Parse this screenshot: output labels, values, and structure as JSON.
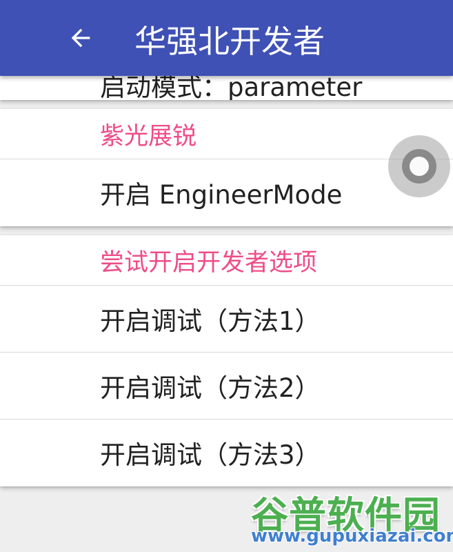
{
  "appbar": {
    "title": "华强北开发者",
    "back_icon": "arrow-back-icon",
    "color": "#3f51b5"
  },
  "cut_item": {
    "label": "启动模式：parameter"
  },
  "sections": [
    {
      "header": "紫光展锐",
      "items": [
        "开启 EngineerMode"
      ]
    },
    {
      "header": "尝试开启开发者选项",
      "items": [
        "开启调试（方法1）",
        "开启调试（方法2）",
        "开启调试（方法3）"
      ]
    }
  ],
  "floating_button": {
    "icon": "circle-ring-icon"
  },
  "watermark": {
    "brand": "谷普软件园",
    "url": "www.gupuxiazai.com"
  },
  "colors": {
    "accent": "#ee4d88",
    "text": "#212121",
    "watermark_green": "#4caf50"
  }
}
